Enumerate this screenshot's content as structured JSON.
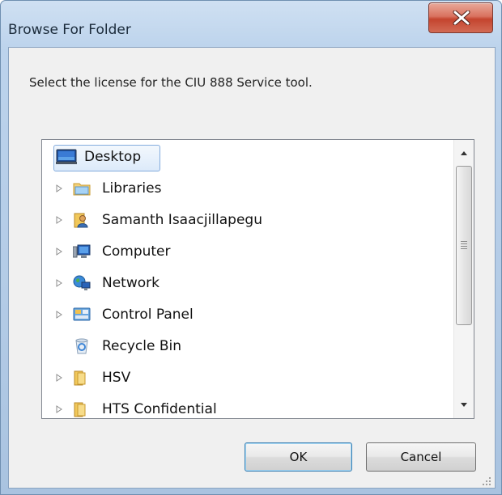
{
  "window": {
    "title": "Browse For Folder",
    "close_glyph": "X"
  },
  "dialog": {
    "description": "Select the license for the CIU 888 Service tool."
  },
  "tree": {
    "items": [
      {
        "label": "Desktop",
        "icon": "desktop-icon",
        "expandable": false,
        "selected": true
      },
      {
        "label": "Libraries",
        "icon": "libraries-folder-icon",
        "expandable": true
      },
      {
        "label": "Samanth Isaacjillapegu",
        "icon": "user-folder-icon",
        "expandable": true
      },
      {
        "label": "Computer",
        "icon": "computer-icon",
        "expandable": true
      },
      {
        "label": "Network",
        "icon": "network-icon",
        "expandable": true
      },
      {
        "label": "Control Panel",
        "icon": "control-panel-icon",
        "expandable": true
      },
      {
        "label": "Recycle Bin",
        "icon": "recycle-bin-icon",
        "expandable": false
      },
      {
        "label": "HSV",
        "icon": "folder-icon",
        "expandable": true
      },
      {
        "label": "HTS Confidential",
        "icon": "folder-icon",
        "expandable": true
      }
    ]
  },
  "buttons": {
    "ok": "OK",
    "cancel": "Cancel"
  },
  "colors": {
    "title_bar": "#b3cbe6",
    "close_button": "#c4442e",
    "selection": "#dceafa",
    "default_button_border": "#3c7fb1"
  }
}
